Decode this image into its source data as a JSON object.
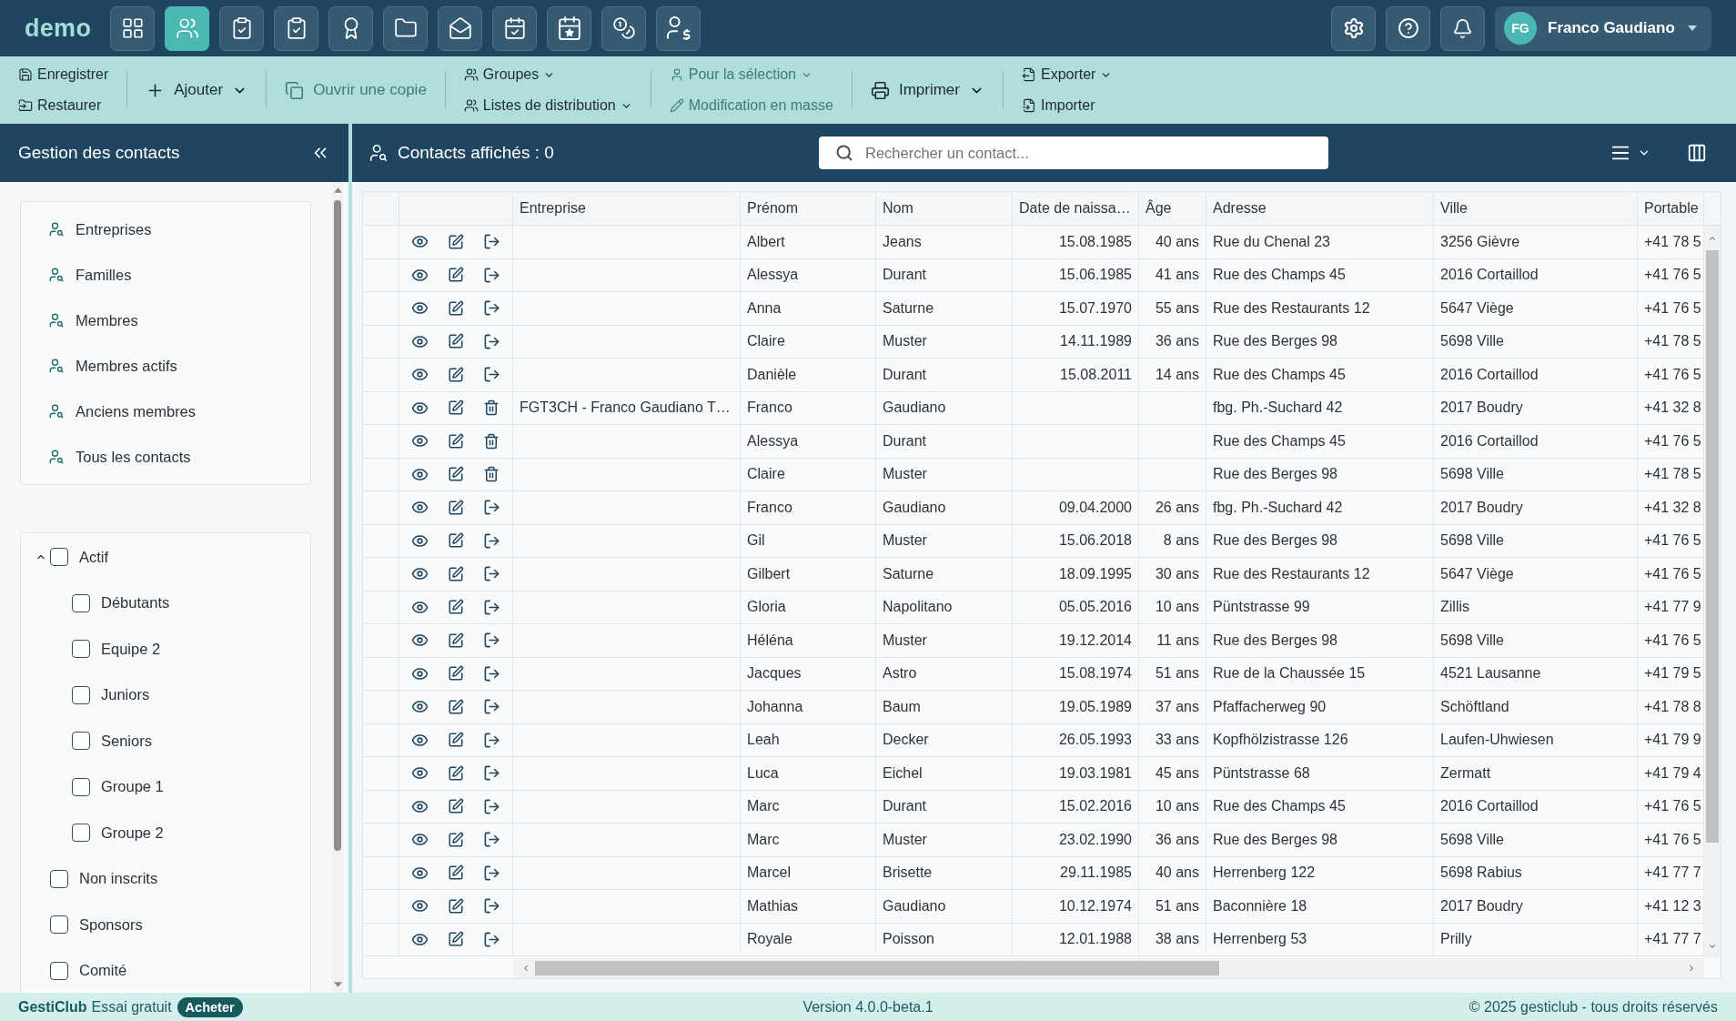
{
  "topbar": {
    "logo": "demo",
    "nav_buttons": [
      {
        "selected": false
      },
      {
        "selected": true
      },
      {
        "selected": false
      },
      {
        "selected": false
      },
      {
        "selected": false
      },
      {
        "selected": false
      },
      {
        "selected": false
      },
      {
        "selected": false
      },
      {
        "selected": false
      },
      {
        "selected": false
      },
      {
        "selected": false
      }
    ],
    "user": {
      "initials": "FG",
      "name": "Franco Gaudiano"
    }
  },
  "toolbar": {
    "groups": [
      {
        "items": [
          {
            "label": "Enregistrer",
            "disabled": false,
            "dropdown": false
          },
          {
            "label": "Restaurer",
            "disabled": false,
            "dropdown": false
          }
        ]
      },
      {
        "items": [
          {
            "label": "Ajouter",
            "disabled": false,
            "dropdown": true
          }
        ]
      },
      {
        "items": [
          {
            "label": "Ouvrir une copie",
            "disabled": true,
            "dropdown": false
          }
        ]
      },
      {
        "items": [
          {
            "label": "Groupes",
            "disabled": false,
            "dropdown": true
          },
          {
            "label": "Listes de distribution",
            "disabled": false,
            "dropdown": true
          }
        ]
      },
      {
        "items": [
          {
            "label": "Pour la sélection",
            "disabled": true,
            "dropdown": true
          },
          {
            "label": "Modification en masse",
            "disabled": true,
            "dropdown": false
          }
        ]
      },
      {
        "items": [
          {
            "label": "Imprimer",
            "disabled": false,
            "dropdown": true
          }
        ]
      },
      {
        "items": [
          {
            "label": "Exporter",
            "disabled": false,
            "dropdown": true
          },
          {
            "label": "Importer",
            "disabled": false,
            "dropdown": false
          }
        ]
      }
    ]
  },
  "sidebar": {
    "title": "Gestion des contacts",
    "views": [
      {
        "label": "Entreprises"
      },
      {
        "label": "Familles"
      },
      {
        "label": "Membres"
      },
      {
        "label": "Membres actifs"
      },
      {
        "label": "Anciens membres"
      },
      {
        "label": "Tous les contacts"
      }
    ],
    "groups": [
      {
        "label": "Actif",
        "checked": false,
        "expanded": true,
        "children": [
          {
            "label": "Débutants",
            "checked": false
          },
          {
            "label": "Equipe 2",
            "checked": false
          },
          {
            "label": "Juniors",
            "checked": false
          },
          {
            "label": "Seniors",
            "checked": false
          },
          {
            "label": "Groupe 1",
            "checked": false
          },
          {
            "label": "Groupe 2",
            "checked": false
          }
        ]
      },
      {
        "label": "Non inscrits",
        "checked": false
      },
      {
        "label": "Sponsors",
        "checked": false
      },
      {
        "label": "Comité",
        "checked": false
      }
    ]
  },
  "content": {
    "title": "Contacts affichés : 0",
    "search": {
      "placeholder": "Rechercher un contact..."
    }
  },
  "table": {
    "columns": [
      "Entreprise",
      "Prénom",
      "Nom",
      "Date de naissa…",
      "Âge",
      "Adresse",
      "Ville",
      "Portable"
    ],
    "rows": [
      {
        "kind": "member",
        "first_name": "Albert",
        "last_name": "Jeans",
        "birth_date": "15.08.1985",
        "age": "40 ans",
        "address": "Rue du Chenal 23",
        "city": "3256 Gièvre",
        "mobile": "+41 78 5"
      },
      {
        "kind": "member",
        "first_name": "Alessya",
        "last_name": "Durant",
        "birth_date": "15.06.1985",
        "age": "41 ans",
        "address": "Rue des Champs 45",
        "city": "2016 Cortaillod",
        "mobile": "+41 76 5"
      },
      {
        "kind": "member",
        "first_name": "Anna",
        "last_name": "Saturne",
        "birth_date": "15.07.1970",
        "age": "55 ans",
        "address": "Rue des Restaurants 12",
        "city": "5647 Viège",
        "mobile": "+41 76 5"
      },
      {
        "kind": "member",
        "first_name": "Claire",
        "last_name": "Muster",
        "birth_date": "14.11.1989",
        "age": "36 ans",
        "address": "Rue des Berges 98",
        "city": "5698 Ville",
        "mobile": "+41 78 5"
      },
      {
        "kind": "member",
        "first_name": "Danièle",
        "last_name": "Durant",
        "birth_date": "15.08.2011",
        "age": "14 ans",
        "address": "Rue des Champs 45",
        "city": "2016 Cortaillod",
        "mobile": "+41 76 5"
      },
      {
        "kind": "contact",
        "company": "FGT3CH - Franco Gaudiano T…",
        "first_name": "Franco",
        "last_name": "Gaudiano",
        "address": "fbg. Ph.-Suchard 42",
        "city": "2017 Boudry",
        "mobile": "+41 32 8"
      },
      {
        "kind": "contact",
        "first_name": "Alessya",
        "last_name": "Durant",
        "address": "Rue des Champs 45",
        "city": "2016 Cortaillod",
        "mobile": "+41 76 5"
      },
      {
        "kind": "contact",
        "first_name": "Claire",
        "last_name": "Muster",
        "address": "Rue des Berges 98",
        "city": "5698 Ville",
        "mobile": "+41 78 5"
      },
      {
        "kind": "member",
        "first_name": "Franco",
        "last_name": "Gaudiano",
        "birth_date": "09.04.2000",
        "age": "26 ans",
        "address": "fbg. Ph.-Suchard 42",
        "city": "2017 Boudry",
        "mobile": "+41 32 8"
      },
      {
        "kind": "member",
        "first_name": "Gil",
        "last_name": "Muster",
        "birth_date": "15.06.2018",
        "age": "8 ans",
        "address": "Rue des Berges 98",
        "city": "5698 Ville",
        "mobile": "+41 76 5"
      },
      {
        "kind": "member",
        "first_name": "Gilbert",
        "last_name": "Saturne",
        "birth_date": "18.09.1995",
        "age": "30 ans",
        "address": "Rue des Restaurants 12",
        "city": "5647 Viège",
        "mobile": "+41 76 5"
      },
      {
        "kind": "member",
        "first_name": "Gloria",
        "last_name": "Napolitano",
        "birth_date": "05.05.2016",
        "age": "10 ans",
        "address": "Püntstrasse 99",
        "city": "Zillis",
        "mobile": "+41 77 9"
      },
      {
        "kind": "member",
        "first_name": "Héléna",
        "last_name": "Muster",
        "birth_date": "19.12.2014",
        "age": "11 ans",
        "address": "Rue des Berges 98",
        "city": "5698 Ville",
        "mobile": "+41 76 5"
      },
      {
        "kind": "member",
        "first_name": "Jacques",
        "last_name": "Astro",
        "birth_date": "15.08.1974",
        "age": "51 ans",
        "address": "Rue de la Chaussée 15",
        "city": "4521 Lausanne",
        "mobile": "+41 79 5"
      },
      {
        "kind": "member",
        "first_name": "Johanna",
        "last_name": "Baum",
        "birth_date": "19.05.1989",
        "age": "37 ans",
        "address": "Pfaffacherweg 90",
        "city": "Schöftland",
        "mobile": "+41 78 8"
      },
      {
        "kind": "member",
        "first_name": "Leah",
        "last_name": "Decker",
        "birth_date": "26.05.1993",
        "age": "33 ans",
        "address": "Kopfhölzistrasse 126",
        "city": "Laufen-Uhwiesen",
        "mobile": "+41 79 9"
      },
      {
        "kind": "member",
        "first_name": "Luca",
        "last_name": "Eichel",
        "birth_date": "19.03.1981",
        "age": "45 ans",
        "address": "Püntstrasse 68",
        "city": "Zermatt",
        "mobile": "+41 79 4"
      },
      {
        "kind": "member",
        "first_name": "Marc",
        "last_name": "Durant",
        "birth_date": "15.02.2016",
        "age": "10 ans",
        "address": "Rue des Champs 45",
        "city": "2016 Cortaillod",
        "mobile": "+41 76 5"
      },
      {
        "kind": "member",
        "first_name": "Marc",
        "last_name": "Muster",
        "birth_date": "23.02.1990",
        "age": "36 ans",
        "address": "Rue des Berges 98",
        "city": "5698 Ville",
        "mobile": "+41 76 5"
      },
      {
        "kind": "member",
        "first_name": "Marcel",
        "last_name": "Brisette",
        "birth_date": "29.11.1985",
        "age": "40 ans",
        "address": "Herrenberg 122",
        "city": "5698 Rabius",
        "mobile": "+41 77 7"
      },
      {
        "kind": "member",
        "first_name": "Mathias",
        "last_name": "Gaudiano",
        "birth_date": "10.12.1974",
        "age": "51 ans",
        "address": "Baconnière 18",
        "city": "2017 Boudry",
        "mobile": "+41 12 3"
      },
      {
        "kind": "member",
        "first_name": "Royale",
        "last_name": "Poisson",
        "birth_date": "12.01.1988",
        "age": "38 ans",
        "address": "Herrenberg 53",
        "city": "Prilly",
        "mobile": "+41 77 7"
      }
    ]
  },
  "footer": {
    "brand": "GestiClub",
    "plan": "Essai gratuit",
    "buy": "Acheter",
    "version": "Version 4.0.0-beta.1",
    "copyright": "© 2025 gesticlub - tous droits réservés"
  }
}
